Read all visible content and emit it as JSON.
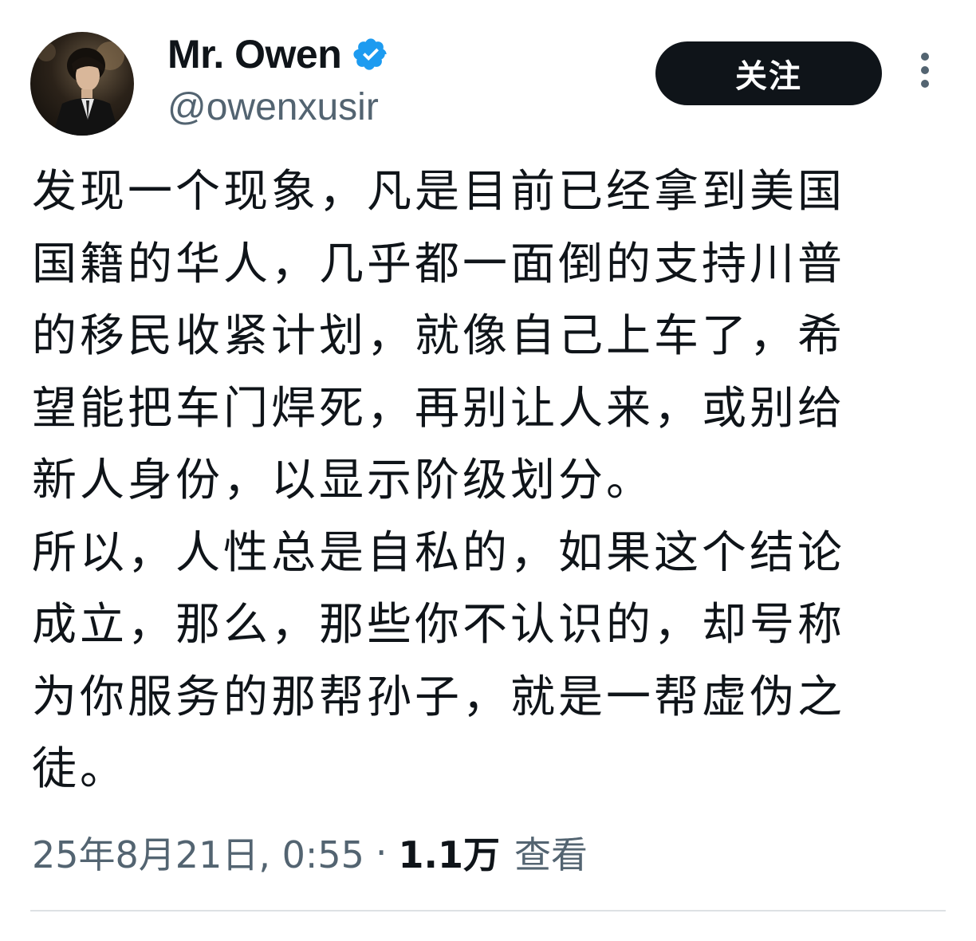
{
  "author": {
    "display_name": "Mr. Owen",
    "handle": "@owenxusir",
    "verified": true
  },
  "follow_button": {
    "label": "关注"
  },
  "more_icon": "more-vertical-icon",
  "tweet": {
    "lines": [
      "发现一个现象，凡是目前已经拿到美国",
      "国籍的华人，几乎都一面倒的支持川普",
      "的移民收紧计划，就像自己上车了，希",
      "望能把车门焊死，再别让人来，或别给",
      "新人身份，以显示阶级划分。",
      "所以，人性总是自私的，如果这个结论",
      "成立，那么，那些你不认识的，却号称",
      "为你服务的那帮孙子，就是一帮虚伪之",
      "徒。"
    ]
  },
  "meta": {
    "timestamp": "25年8月21日, 0:55",
    "separator": "·",
    "views_count": "1.1万",
    "views_label": "查看"
  },
  "colors": {
    "text": "#0f1419",
    "secondary": "#536471",
    "verified_badge": "#1d9bf0",
    "button_bg": "#0f1419"
  }
}
